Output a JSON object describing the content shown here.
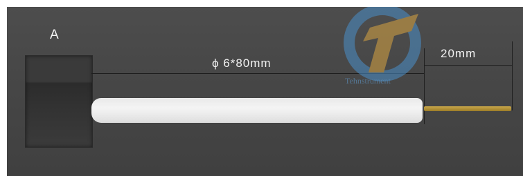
{
  "labels": {
    "figure_letter": "A",
    "rod_dimension": "ϕ 6*80mm",
    "wire_dimension": "20mm"
  },
  "watermark": {
    "text": "Tehnstrument"
  },
  "colors": {
    "background": "#444444",
    "rod": "#f0f0f0",
    "wire": "#b8962e",
    "plate": "#333333",
    "text": "#f2f2f2"
  }
}
